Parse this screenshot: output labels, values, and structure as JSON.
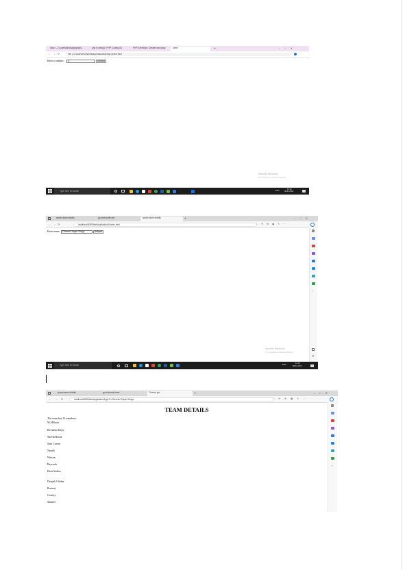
{
  "screenshot1": {
    "tabs": [
      {
        "label": "Inbox - 21 userMlshokal@gmail.c"
      },
      {
        "label": "php in array() | PHP Coding Gu"
      },
      {
        "label": "PHP Exercises: Create new array"
      },
      {
        "label": "prime"
      }
    ],
    "address": "File | C:/Users/HDSI/Desktop/htdocs/MySQL/prime.html",
    "form": {
      "label": "Enter a number:",
      "value": "4",
      "button": "Submit"
    },
    "watermark": {
      "title": "Activate Windows",
      "subtitle": "Go to Settings to activate Windows."
    },
    "taskbar": {
      "search": "Type here to search",
      "time": "12:34",
      "date": "08-01-2023",
      "lang": "ENG"
    }
  },
  "screenshot2": {
    "tabs": [
      {
        "label": "sports team details"
      },
      {
        "label": "go.microsoft.com"
      },
      {
        "label": "sports team details"
      }
    ],
    "address": "localhost:8080/WebApplication1/index.html",
    "form": {
      "label": "Enter name:",
      "value": "Chennai Super Kings",
      "button": "Submit"
    },
    "watermark": {
      "title": "Activate Windows",
      "subtitle": "Go to Settings to activate Windows."
    },
    "taskbar": {
      "search": "Type here to search",
      "time": "12:16",
      "date": "08-01-2023",
      "lang": "ENG"
    }
  },
  "screenshot3": {
    "tabs": [
      {
        "label": "sports team details"
      },
      {
        "label": "go.microsoft.com"
      },
      {
        "label": "Servlet gvt"
      }
    ],
    "address": "localhost:8080/WebApplication1/gvt?t=Chennai+Super+Kings",
    "heading": "TEAM DETAILS",
    "summary": "The team has 12 members:",
    "members": [
      "M.SDhoni",
      "Ravindra Jdeja",
      "Suresh Raina",
      "Sam Curren",
      "Negidi",
      "Watson",
      "Bayrudu",
      "Bens Stokes",
      "Deepak Chahar",
      "Ruturaj",
      "Convay",
      "Santner"
    ]
  },
  "colors": {
    "chrome_tabbar": "#f0e2f3",
    "edge_tabbar": "#d9d9d9",
    "taskbar": "#1c1c1c",
    "edge_accent": "#1a73e8"
  },
  "icons": [
    "windows-logo-icon",
    "search-icon",
    "cortana-icon",
    "task-view-icon",
    "file-explorer-icon",
    "edge-icon",
    "chrome-icon",
    "mail-icon",
    "back-icon",
    "forward-icon",
    "reload-icon",
    "bing-icon"
  ]
}
